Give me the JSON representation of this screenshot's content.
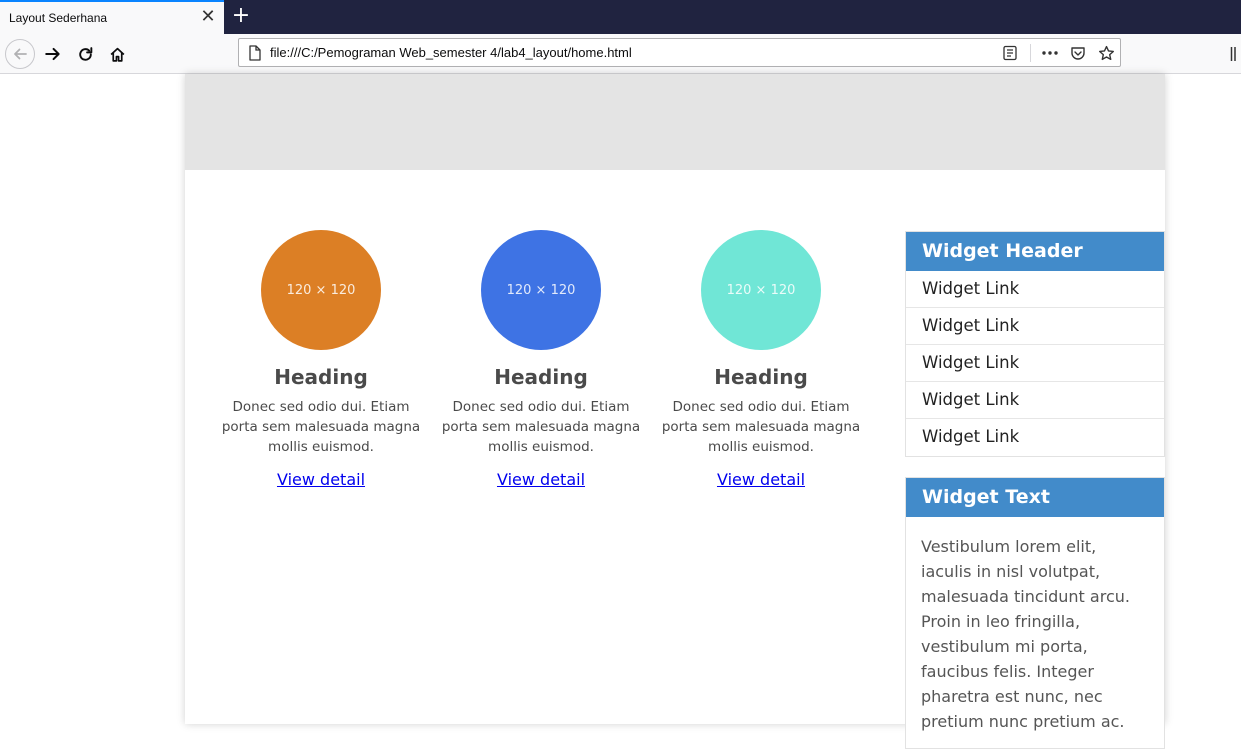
{
  "browser": {
    "tab_title": "Layout Sederhana",
    "tab_close": "✕",
    "new_tab": "+",
    "url": "file:///C:/Pemograman Web_semester 4/lab4_layout/home.html"
  },
  "cards": [
    {
      "image_text": "120 × 120",
      "color": "#dc7f25",
      "heading": "Heading",
      "text": "Donec sed odio dui. Etiam porta sem malesuada magna mollis euismod.",
      "link": "View detail"
    },
    {
      "image_text": "120 × 120",
      "color": "#3e73e4",
      "heading": "Heading",
      "text": "Donec sed odio dui. Etiam porta sem malesuada magna mollis euismod.",
      "link": "View detail"
    },
    {
      "image_text": "120 × 120",
      "color": "#70e6d6",
      "heading": "Heading",
      "text": "Donec sed odio dui. Etiam porta sem malesuada magna mollis euismod.",
      "link": "View detail"
    }
  ],
  "widgets": {
    "links_header": "Widget Header",
    "links": [
      "Widget Link",
      "Widget Link",
      "Widget Link",
      "Widget Link",
      "Widget Link"
    ],
    "text_header": "Widget Text",
    "text_body": "Vestibulum lorem elit, iaculis in nisl volutpat, malesuada tincidunt arcu. Proin in leo fringilla, vestibulum mi porta, faucibus felis. Integer pharetra est nunc, nec pretium nunc pretium ac."
  },
  "colors": {
    "widget_header": "#428bca",
    "header_band": "#e4e4e4",
    "tabbar": "#202340"
  }
}
